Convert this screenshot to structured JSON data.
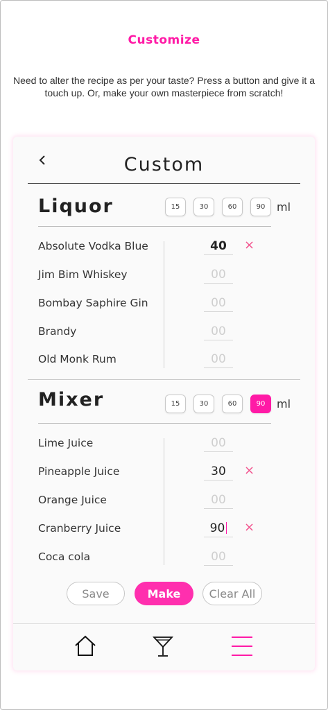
{
  "page": {
    "title": "Customize",
    "intro": "Need to alter the recipe as per your taste? Press a button and give it a touch up. Or, make your own masterpiece from scratch!"
  },
  "card": {
    "title": "Custom",
    "back_icon": "chevron-left-icon"
  },
  "liquor": {
    "title": "Liquor",
    "chips": [
      {
        "label": "15",
        "active": false
      },
      {
        "label": "30",
        "active": false
      },
      {
        "label": "60",
        "active": false
      },
      {
        "label": "90",
        "active": false
      }
    ],
    "unit": "ml",
    "items": [
      {
        "name": "Absolute Vodka Blue",
        "qty": "40",
        "filled": true
      },
      {
        "name": "Jim Bim Whiskey",
        "qty": "00",
        "filled": false
      },
      {
        "name": "Bombay Saphire Gin",
        "qty": "00",
        "filled": false
      },
      {
        "name": "Brandy",
        "qty": "00",
        "filled": false
      },
      {
        "name": "Old Monk Rum",
        "qty": "00",
        "filled": false
      }
    ]
  },
  "mixer": {
    "title": "Mixer",
    "chips": [
      {
        "label": "15",
        "active": false
      },
      {
        "label": "30",
        "active": false
      },
      {
        "label": "60",
        "active": false
      },
      {
        "label": "90",
        "active": true
      }
    ],
    "unit": "ml",
    "items": [
      {
        "name": "Lime Juice",
        "qty": "00",
        "filled": false
      },
      {
        "name": "Pineapple Juice",
        "qty": "30",
        "filled": true
      },
      {
        "name": "Orange Juice",
        "qty": "00",
        "filled": false
      },
      {
        "name": "Cranberry Juice",
        "qty": "90",
        "filled": true
      },
      {
        "name": "Coca cola",
        "qty": "00",
        "filled": false
      }
    ]
  },
  "actions": {
    "save": "Save",
    "make": "Make",
    "clear": "Clear All"
  },
  "remove_icon": "×",
  "nav": {
    "home_icon": "home-icon",
    "cocktail_icon": "cocktail-glass-icon",
    "menu_icon": "hamburger-menu-icon"
  },
  "colors": {
    "accent": "#ff1aa6",
    "remove": "#f2558f"
  }
}
